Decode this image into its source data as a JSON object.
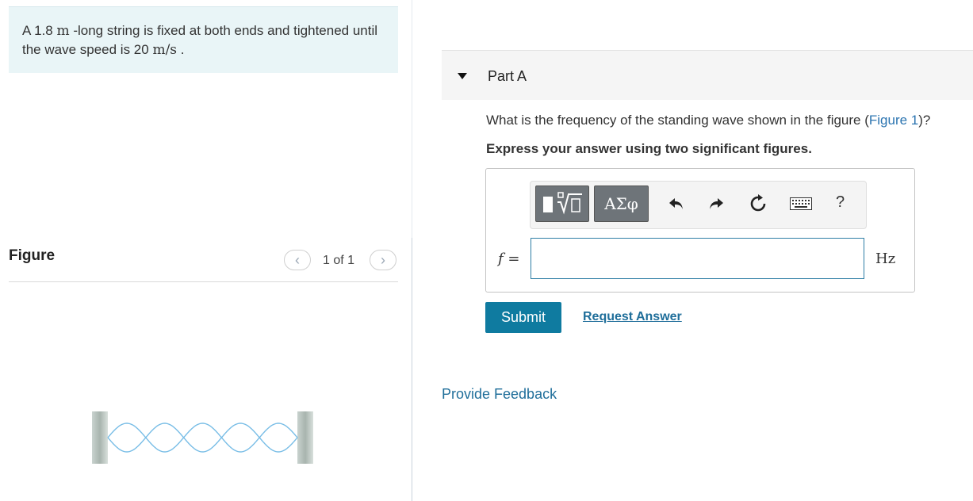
{
  "problem": {
    "text_prefix": "A 1.8 ",
    "length_unit": "m",
    "text_middle": " -long string is fixed at both ends and tightened until the wave speed is 20 ",
    "speed_unit": "m/s",
    "text_suffix": " ."
  },
  "figure": {
    "label": "Figure",
    "pager_prev": "‹",
    "pager_next": "›",
    "pager_count": "1 of 1",
    "wave_mode": 5,
    "colors": {
      "wave": "#78bde6",
      "wall": "#a8b4ae"
    }
  },
  "part": {
    "title": "Part A",
    "question_prefix": "What is the frequency of the standing wave shown in the figure (",
    "question_link": "Figure 1",
    "question_suffix": ")?",
    "instruction": "Express your answer using two significant figures."
  },
  "toolbar": {
    "template_icon": "templates-icon",
    "greek_label": "ΑΣφ",
    "undo_icon": "undo-icon",
    "redo_icon": "redo-icon",
    "reset_icon": "reset-icon",
    "keyboard_icon": "keyboard-icon",
    "help_label": "?"
  },
  "answer": {
    "variable": "f",
    "equals": " =",
    "value": "",
    "unit": "Hz"
  },
  "actions": {
    "submit_label": "Submit",
    "request_label": "Request Answer",
    "feedback_label": "Provide Feedback"
  },
  "colors": {
    "accent": "#0f7ba0",
    "link": "#1f6e9a",
    "problem_bg": "#e9f5f7"
  }
}
